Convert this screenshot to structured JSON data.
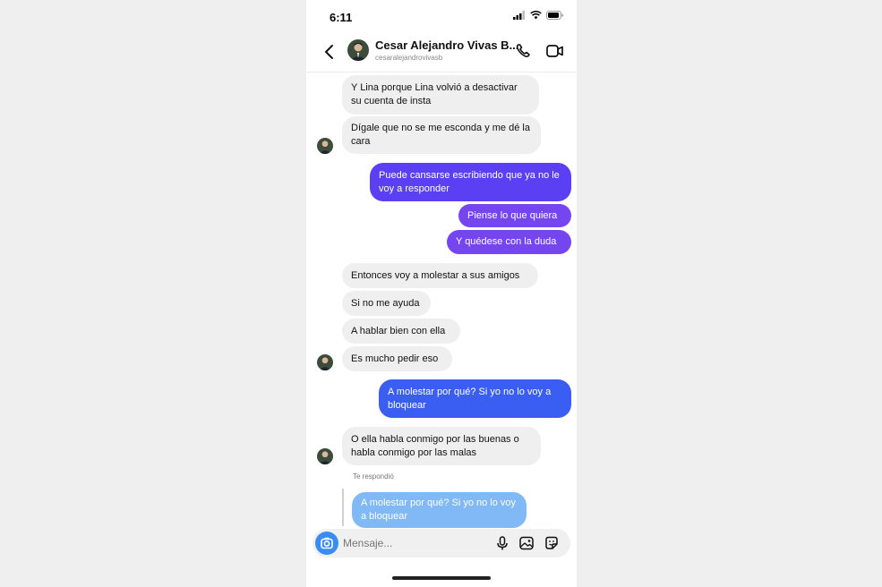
{
  "status": {
    "time": "6:11"
  },
  "header": {
    "contact_name": "Cesar Alejandro Vivas B...",
    "username": "cesaralejandrovivasb"
  },
  "messages": [
    {
      "text": "Y Lina porque Lina volvió a desactivar su cuenta de insta",
      "from": "them"
    },
    {
      "text": "Dígale que no se me esconda y me dé la cara",
      "from": "them"
    },
    {
      "text": "Puede cansarse escribiendo que ya no le voy a responder",
      "from": "me"
    },
    {
      "text": "Piense lo que quiera",
      "from": "me"
    },
    {
      "text": "Y quédese con la duda",
      "from": "me"
    },
    {
      "text": "Entonces voy a molestar a sus amigos",
      "from": "them"
    },
    {
      "text": "Si no me ayuda",
      "from": "them"
    },
    {
      "text": "A hablar bien con ella",
      "from": "them"
    },
    {
      "text": "Es mucho pedir eso",
      "from": "them"
    },
    {
      "text": "A molestar por qué? Si yo no lo voy a bloquear",
      "from": "me"
    },
    {
      "text": "O ella habla conmigo por las buenas o habla conmigo por las malas",
      "from": "them"
    }
  ],
  "reply": {
    "label": "Te respondió",
    "quoted_text": "A molestar por qué? Si yo no lo voy a bloquear"
  },
  "composer": {
    "placeholder": "Mensaje..."
  },
  "colors": {
    "incoming": "#efefef",
    "outgoing_purple": "#5b3ff2",
    "outgoing_violet": "#7546f0",
    "outgoing_blue": "#3b5ef2",
    "reply_quote": "#7ab6f5",
    "camera_button": "#3a8cf5"
  }
}
